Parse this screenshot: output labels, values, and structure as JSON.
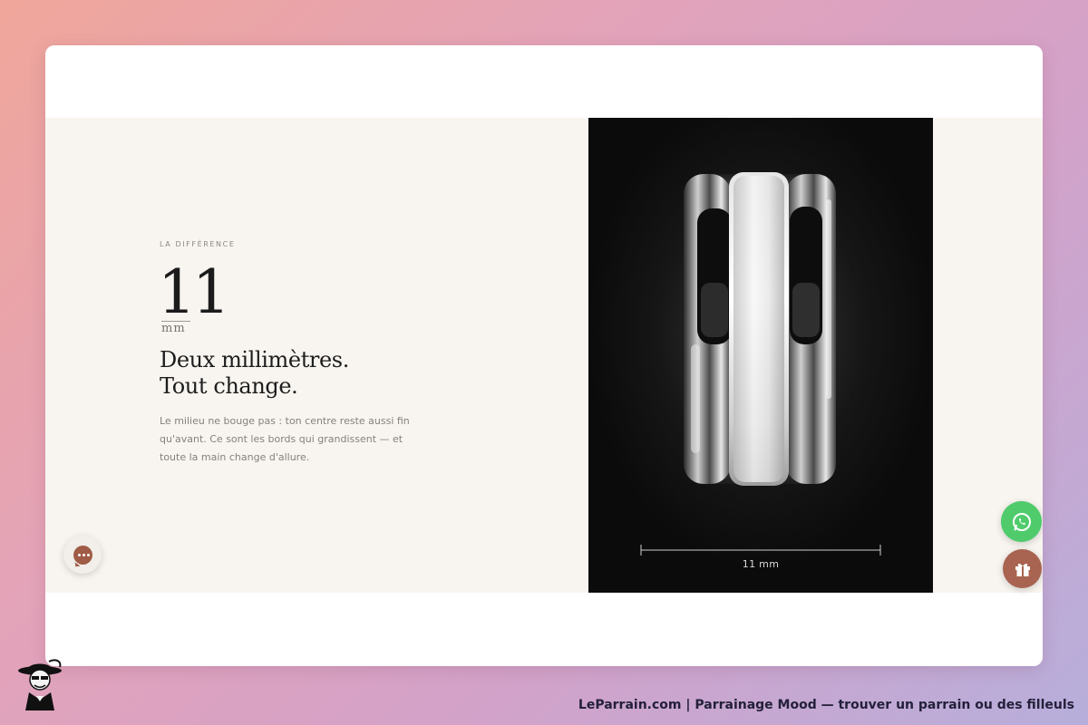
{
  "section": {
    "eyebrow": "LA DIFFÉRENCE",
    "number": "11",
    "unit": "mm",
    "headline_line1": "Deux millimètres.",
    "headline_line2": "Tout change.",
    "body": "Le milieu ne bouge pas : ton centre reste aussi fin qu'avant. Ce sont les bords qui grandissent — et toute la main change d'allure."
  },
  "photo": {
    "measure_label": "11 mm"
  },
  "widgets": {
    "chat_icon": "chat-bubble-icon",
    "whatsapp_icon": "whatsapp-icon",
    "gift_icon": "gift-icon"
  },
  "footer": {
    "caption": "LeParrain.com | Parrainage Mood — trouver un parrain ou des filleuls"
  },
  "colors": {
    "section_bg": "#f8f5f0",
    "accent_brown": "#a86451",
    "whatsapp_green": "#4fcb6c",
    "photo_bg": "#0b0b0b"
  }
}
